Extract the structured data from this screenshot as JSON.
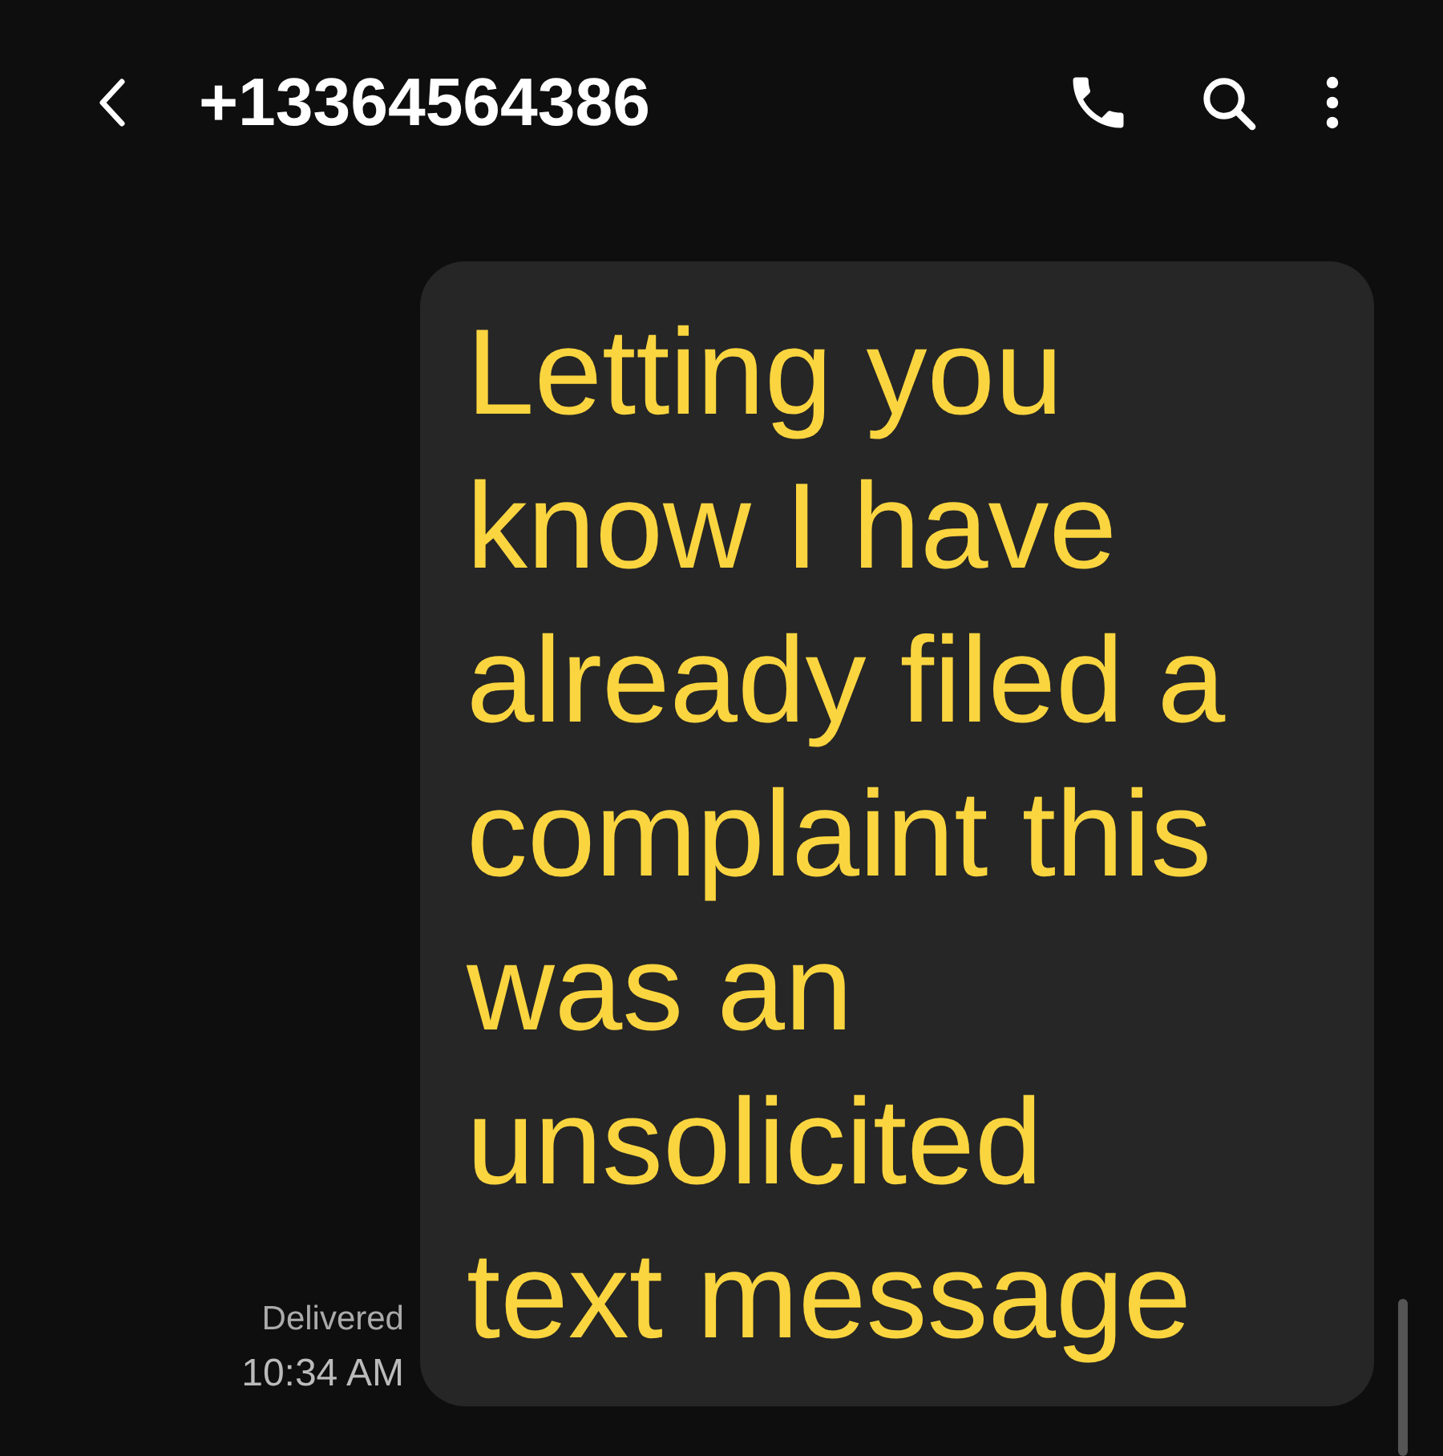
{
  "header": {
    "title": "+13364564386"
  },
  "messages": [
    {
      "text": "Letting you know I have already filed a complaint this was an unsolicited text message",
      "status": "Delivered",
      "time": "10:34 AM"
    }
  ]
}
